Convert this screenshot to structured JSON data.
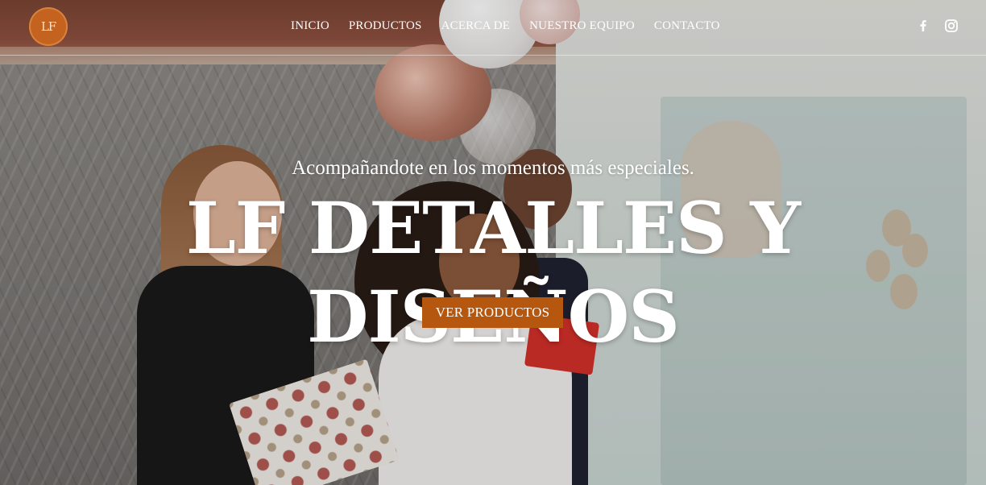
{
  "header": {
    "logo_text": "LF",
    "nav": [
      {
        "label": "INICIO"
      },
      {
        "label": "PRODUCTOS"
      },
      {
        "label": "ACERCA DE"
      },
      {
        "label": "NUESTRO EQUIPO"
      },
      {
        "label": "CONTACTO"
      }
    ],
    "social": [
      {
        "icon": "facebook-icon"
      },
      {
        "icon": "instagram-icon"
      }
    ]
  },
  "hero": {
    "tagline": "Acompañandote en los momentos más especiales.",
    "title": "LF DETALLES Y DISEÑOS",
    "cta_label": "VER PRODUCTOS"
  },
  "colors": {
    "accent": "#B6570F",
    "logo_bg": "#C4621F",
    "text": "#FFFFFF"
  }
}
